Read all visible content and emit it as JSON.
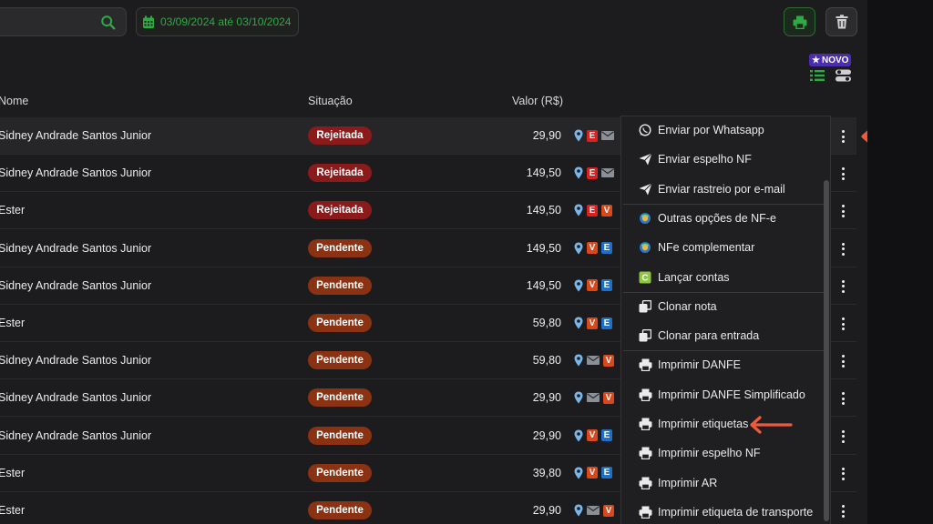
{
  "toolbar": {
    "search_placeholder": "",
    "date_range": "03/09/2024 até 03/10/2024",
    "new_badge": "NOVO"
  },
  "table": {
    "headers": {
      "name": "Nome",
      "status": "Situação",
      "value": "Valor (R$)"
    },
    "rows": [
      {
        "name": "Sidney Andrade Santos Junior",
        "status": "Rejeitada",
        "kind": "rej",
        "value": "29,90",
        "icons": [
          "pin",
          "E",
          "mail"
        ]
      },
      {
        "name": "Sidney Andrade Santos Junior",
        "status": "Rejeitada",
        "kind": "rej",
        "value": "149,50",
        "icons": [
          "pin",
          "E",
          "mail"
        ]
      },
      {
        "name": "Ester",
        "status": "Rejeitada",
        "kind": "rej",
        "value": "149,50",
        "icons": [
          "pin",
          "E",
          "V"
        ]
      },
      {
        "name": "Sidney Andrade Santos Junior",
        "status": "Pendente",
        "kind": "pen",
        "value": "149,50",
        "icons": [
          "pin",
          "V",
          "E"
        ]
      },
      {
        "name": "Sidney Andrade Santos Junior",
        "status": "Pendente",
        "kind": "pen",
        "value": "149,50",
        "icons": [
          "pin",
          "V",
          "E"
        ]
      },
      {
        "name": "Ester",
        "status": "Pendente",
        "kind": "pen",
        "value": "59,80",
        "icons": [
          "pin",
          "V",
          "E"
        ]
      },
      {
        "name": "Sidney Andrade Santos Junior",
        "status": "Pendente",
        "kind": "pen",
        "value": "59,80",
        "icons": [
          "pin",
          "mail",
          "V"
        ]
      },
      {
        "name": "Sidney Andrade Santos Junior",
        "status": "Pendente",
        "kind": "pen",
        "value": "29,90",
        "icons": [
          "pin",
          "mail",
          "V"
        ]
      },
      {
        "name": "Sidney Andrade Santos Junior",
        "status": "Pendente",
        "kind": "pen",
        "value": "29,90",
        "icons": [
          "pin",
          "V",
          "E"
        ]
      },
      {
        "name": "Ester",
        "status": "Pendente",
        "kind": "pen",
        "value": "39,80",
        "icons": [
          "pin",
          "V",
          "E"
        ]
      },
      {
        "name": "Ester",
        "status": "Pendente",
        "kind": "pen",
        "value": "29,90",
        "icons": [
          "pin",
          "mail",
          "V"
        ]
      }
    ]
  },
  "menu": {
    "items": [
      {
        "label": "Enviar por Whatsapp",
        "icon": "whatsapp-icon"
      },
      {
        "label": "Enviar espelho NF",
        "icon": "send-icon"
      },
      {
        "label": "Enviar rastreio por e-mail",
        "icon": "send-icon"
      },
      {
        "label": "Outras opções de NF-e",
        "icon": "nfe-icon"
      },
      {
        "label": "NFe complementar",
        "icon": "nfe-icon"
      },
      {
        "label": "Lançar contas",
        "icon": "contas-icon"
      },
      {
        "label": "Clonar nota",
        "icon": "clone-icon"
      },
      {
        "label": "Clonar para entrada",
        "icon": "clone-icon"
      },
      {
        "label": "Imprimir DANFE",
        "icon": "printer-icon"
      },
      {
        "label": "Imprimir DANFE Simplificado",
        "icon": "printer-icon"
      },
      {
        "label": "Imprimir etiquetas",
        "icon": "printer-icon"
      },
      {
        "label": "Imprimir espelho NF",
        "icon": "printer-icon"
      },
      {
        "label": "Imprimir AR",
        "icon": "printer-icon"
      },
      {
        "label": "Imprimir etiqueta de transporte",
        "icon": "printer-icon"
      }
    ]
  },
  "colors": {
    "accent_green": "#2eaa45",
    "rejected": "#8b1a1a",
    "pending": "#8a3212",
    "annotation_arrow": "#ee5a3c",
    "badge_e_red": "#d8221f",
    "badge_v_orange": "#d9481d",
    "badge_e_blue": "#1f6fc7"
  }
}
